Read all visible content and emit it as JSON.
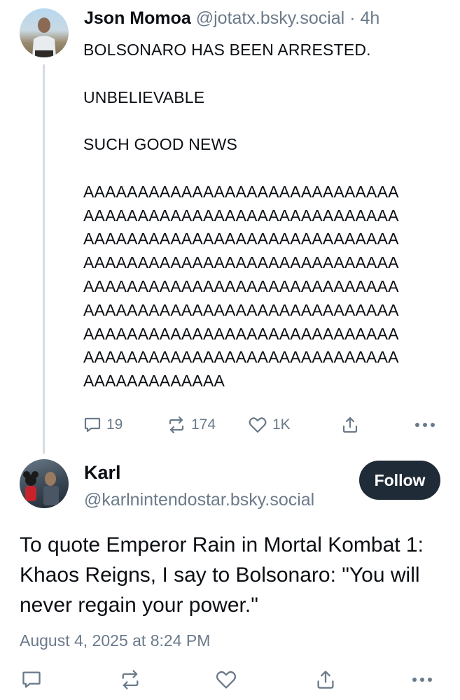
{
  "parent_post": {
    "author_name": "Json Momoa",
    "author_handle": "@jotatx.bsky.social",
    "separator": "·",
    "age": "4h",
    "text_lines": [
      "BOLSONARO HAS BEEN ARRESTED.",
      "",
      "UNBELIEVABLE",
      "",
      "SUCH GOOD NEWS",
      "",
      "AAAAAAAAAAAAAAAAAAAAAAAAAAAAA",
      "AAAAAAAAAAAAAAAAAAAAAAAAAAAAA",
      "AAAAAAAAAAAAAAAAAAAAAAAAAAAAA",
      "AAAAAAAAAAAAAAAAAAAAAAAAAAAAA",
      "AAAAAAAAAAAAAAAAAAAAAAAAAAAAA",
      "AAAAAAAAAAAAAAAAAAAAAAAAAAAAA",
      "AAAAAAAAAAAAAAAAAAAAAAAAAAAAA",
      "AAAAAAAAAAAAAAAAAAAAAAAAAAAAA",
      "AAAAAAAAAAAAA"
    ],
    "reply_count": "19",
    "repost_count": "174",
    "like_count": "1K"
  },
  "reply_post": {
    "author_name": "Karl",
    "author_handle": "@karlnintendostar.bsky.social",
    "follow_label": "Follow",
    "text": "To quote Emperor Rain in Mortal Kombat 1: Khaos Reigns, I say to Bolsonaro: \"You will never regain your power.\"",
    "timestamp": "August 4, 2025 at 8:24 PM"
  },
  "icons": {
    "reply": "speech-bubble-icon",
    "repost": "repost-arrows-icon",
    "like": "heart-icon",
    "share": "share-upload-icon",
    "more": "ellipsis-icon"
  },
  "colors": {
    "muted": "#6b7a8a",
    "follow_button": "#1f2b37",
    "thread_line": "#d4dbe2"
  }
}
